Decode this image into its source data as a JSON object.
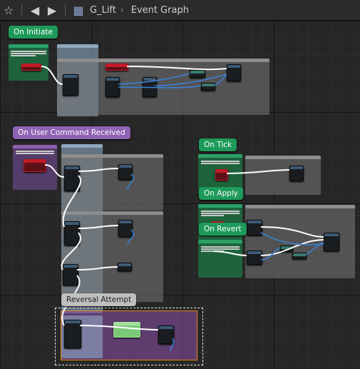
{
  "toolbar": {
    "breadcrumb_graph": "G_Lift",
    "breadcrumb_current": "Event Graph"
  },
  "labels": {
    "on_initiate": "On Initiate",
    "on_user_command": "On User Command Received",
    "on_tick": "On Tick",
    "on_apply": "On Apply",
    "on_revert": "On Revert",
    "reversal_attempt": "Reversal Attempt"
  },
  "colors": {
    "green_tag": "#1e9a5a",
    "purple_tag": "#8f63b3",
    "exec_wire": "#ffffff",
    "data_wire": "#3b82d6",
    "selection_orange": "#e88a17"
  }
}
